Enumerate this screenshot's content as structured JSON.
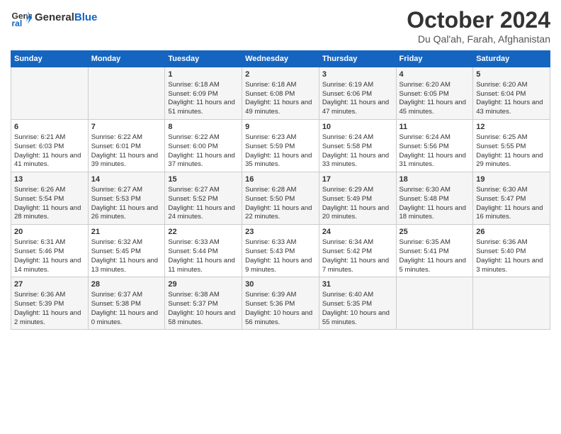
{
  "header": {
    "logo_line1": "General",
    "logo_line2": "Blue",
    "month": "October 2024",
    "location": "Du Qal'ah, Farah, Afghanistan"
  },
  "days_of_week": [
    "Sunday",
    "Monday",
    "Tuesday",
    "Wednesday",
    "Thursday",
    "Friday",
    "Saturday"
  ],
  "weeks": [
    [
      {
        "day": "",
        "sunrise": "",
        "sunset": "",
        "daylight": ""
      },
      {
        "day": "",
        "sunrise": "",
        "sunset": "",
        "daylight": ""
      },
      {
        "day": "1",
        "sunrise": "Sunrise: 6:18 AM",
        "sunset": "Sunset: 6:09 PM",
        "daylight": "Daylight: 11 hours and 51 minutes."
      },
      {
        "day": "2",
        "sunrise": "Sunrise: 6:18 AM",
        "sunset": "Sunset: 6:08 PM",
        "daylight": "Daylight: 11 hours and 49 minutes."
      },
      {
        "day": "3",
        "sunrise": "Sunrise: 6:19 AM",
        "sunset": "Sunset: 6:06 PM",
        "daylight": "Daylight: 11 hours and 47 minutes."
      },
      {
        "day": "4",
        "sunrise": "Sunrise: 6:20 AM",
        "sunset": "Sunset: 6:05 PM",
        "daylight": "Daylight: 11 hours and 45 minutes."
      },
      {
        "day": "5",
        "sunrise": "Sunrise: 6:20 AM",
        "sunset": "Sunset: 6:04 PM",
        "daylight": "Daylight: 11 hours and 43 minutes."
      }
    ],
    [
      {
        "day": "6",
        "sunrise": "Sunrise: 6:21 AM",
        "sunset": "Sunset: 6:03 PM",
        "daylight": "Daylight: 11 hours and 41 minutes."
      },
      {
        "day": "7",
        "sunrise": "Sunrise: 6:22 AM",
        "sunset": "Sunset: 6:01 PM",
        "daylight": "Daylight: 11 hours and 39 minutes."
      },
      {
        "day": "8",
        "sunrise": "Sunrise: 6:22 AM",
        "sunset": "Sunset: 6:00 PM",
        "daylight": "Daylight: 11 hours and 37 minutes."
      },
      {
        "day": "9",
        "sunrise": "Sunrise: 6:23 AM",
        "sunset": "Sunset: 5:59 PM",
        "daylight": "Daylight: 11 hours and 35 minutes."
      },
      {
        "day": "10",
        "sunrise": "Sunrise: 6:24 AM",
        "sunset": "Sunset: 5:58 PM",
        "daylight": "Daylight: 11 hours and 33 minutes."
      },
      {
        "day": "11",
        "sunrise": "Sunrise: 6:24 AM",
        "sunset": "Sunset: 5:56 PM",
        "daylight": "Daylight: 11 hours and 31 minutes."
      },
      {
        "day": "12",
        "sunrise": "Sunrise: 6:25 AM",
        "sunset": "Sunset: 5:55 PM",
        "daylight": "Daylight: 11 hours and 29 minutes."
      }
    ],
    [
      {
        "day": "13",
        "sunrise": "Sunrise: 6:26 AM",
        "sunset": "Sunset: 5:54 PM",
        "daylight": "Daylight: 11 hours and 28 minutes."
      },
      {
        "day": "14",
        "sunrise": "Sunrise: 6:27 AM",
        "sunset": "Sunset: 5:53 PM",
        "daylight": "Daylight: 11 hours and 26 minutes."
      },
      {
        "day": "15",
        "sunrise": "Sunrise: 6:27 AM",
        "sunset": "Sunset: 5:52 PM",
        "daylight": "Daylight: 11 hours and 24 minutes."
      },
      {
        "day": "16",
        "sunrise": "Sunrise: 6:28 AM",
        "sunset": "Sunset: 5:50 PM",
        "daylight": "Daylight: 11 hours and 22 minutes."
      },
      {
        "day": "17",
        "sunrise": "Sunrise: 6:29 AM",
        "sunset": "Sunset: 5:49 PM",
        "daylight": "Daylight: 11 hours and 20 minutes."
      },
      {
        "day": "18",
        "sunrise": "Sunrise: 6:30 AM",
        "sunset": "Sunset: 5:48 PM",
        "daylight": "Daylight: 11 hours and 18 minutes."
      },
      {
        "day": "19",
        "sunrise": "Sunrise: 6:30 AM",
        "sunset": "Sunset: 5:47 PM",
        "daylight": "Daylight: 11 hours and 16 minutes."
      }
    ],
    [
      {
        "day": "20",
        "sunrise": "Sunrise: 6:31 AM",
        "sunset": "Sunset: 5:46 PM",
        "daylight": "Daylight: 11 hours and 14 minutes."
      },
      {
        "day": "21",
        "sunrise": "Sunrise: 6:32 AM",
        "sunset": "Sunset: 5:45 PM",
        "daylight": "Daylight: 11 hours and 13 minutes."
      },
      {
        "day": "22",
        "sunrise": "Sunrise: 6:33 AM",
        "sunset": "Sunset: 5:44 PM",
        "daylight": "Daylight: 11 hours and 11 minutes."
      },
      {
        "day": "23",
        "sunrise": "Sunrise: 6:33 AM",
        "sunset": "Sunset: 5:43 PM",
        "daylight": "Daylight: 11 hours and 9 minutes."
      },
      {
        "day": "24",
        "sunrise": "Sunrise: 6:34 AM",
        "sunset": "Sunset: 5:42 PM",
        "daylight": "Daylight: 11 hours and 7 minutes."
      },
      {
        "day": "25",
        "sunrise": "Sunrise: 6:35 AM",
        "sunset": "Sunset: 5:41 PM",
        "daylight": "Daylight: 11 hours and 5 minutes."
      },
      {
        "day": "26",
        "sunrise": "Sunrise: 6:36 AM",
        "sunset": "Sunset: 5:40 PM",
        "daylight": "Daylight: 11 hours and 3 minutes."
      }
    ],
    [
      {
        "day": "27",
        "sunrise": "Sunrise: 6:36 AM",
        "sunset": "Sunset: 5:39 PM",
        "daylight": "Daylight: 11 hours and 2 minutes."
      },
      {
        "day": "28",
        "sunrise": "Sunrise: 6:37 AM",
        "sunset": "Sunset: 5:38 PM",
        "daylight": "Daylight: 11 hours and 0 minutes."
      },
      {
        "day": "29",
        "sunrise": "Sunrise: 6:38 AM",
        "sunset": "Sunset: 5:37 PM",
        "daylight": "Daylight: 10 hours and 58 minutes."
      },
      {
        "day": "30",
        "sunrise": "Sunrise: 6:39 AM",
        "sunset": "Sunset: 5:36 PM",
        "daylight": "Daylight: 10 hours and 56 minutes."
      },
      {
        "day": "31",
        "sunrise": "Sunrise: 6:40 AM",
        "sunset": "Sunset: 5:35 PM",
        "daylight": "Daylight: 10 hours and 55 minutes."
      },
      {
        "day": "",
        "sunrise": "",
        "sunset": "",
        "daylight": ""
      },
      {
        "day": "",
        "sunrise": "",
        "sunset": "",
        "daylight": ""
      }
    ]
  ]
}
